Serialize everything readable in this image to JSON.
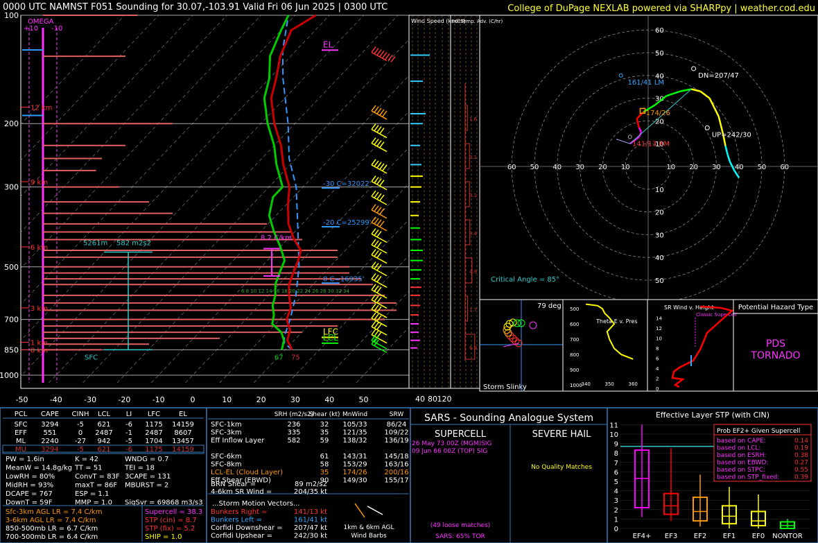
{
  "header": {
    "title": "0000 UTC NAMNST F051 Sounding for 30.07,-103.91 Valid  Fri 06 Jun 2025 | 0300 UTC",
    "credit": "College of DuPage NEXLAB powered via SHARPpy | weather.cod.edu"
  },
  "colors": {
    "temperature": "#cc0000",
    "dewpoint": "#00cc00",
    "parcel": "#3399ff",
    "panel_border": "#3a7ab8",
    "orange": "#ff9900",
    "magenta": "#ff33ff",
    "cyan": "#33cccc",
    "yellow": "#ffff00"
  },
  "skewt": {
    "omega": {
      "label": "OMEGA",
      "left": "+10",
      "right": "-10"
    },
    "pressure_ticks": [
      100,
      200,
      300,
      500,
      700,
      850,
      1000
    ],
    "temp_ticks": [
      -50,
      -40,
      -30,
      -20,
      -10,
      0,
      10,
      20,
      30,
      40,
      50
    ],
    "height_labels": [
      "12 km",
      "9 km",
      "6 km",
      "3 km",
      "1 km",
      "0 km"
    ],
    "height_km": [
      12,
      9,
      6,
      3,
      1,
      0
    ],
    "height_pressure": [
      180,
      290,
      440,
      650,
      810,
      850
    ],
    "EL": {
      "label": "EL",
      "p": 125
    },
    "LFC": {
      "label": "LFC",
      "p": 785
    },
    "LCL": {
      "label": "LCL",
      "p": 815
    },
    "wetbulb_zero": [
      {
        "label": "-30 C=32022'",
        "p": 302
      },
      {
        "label": "-20 C=25299'",
        "p": 387
      },
      {
        "label": "0 C=16935'",
        "p": 555
      }
    ],
    "lapse_label": "8.2 C/km",
    "eff_inflow": {
      "top_label": "5261m",
      "srh_label": "582 m2s2",
      "bottom_label": "SFC",
      "p_top": 455,
      "p_bot": 850
    },
    "sfc_temp": "75",
    "sfc_dwpt": "67",
    "wetbulb_scale": "6 8 10 12 14 16 18 20 22 24 26 28 30 32 34",
    "temperature": [
      [
        850,
        22
      ],
      [
        800,
        18
      ],
      [
        750,
        16
      ],
      [
        700,
        12
      ],
      [
        650,
        10
      ],
      [
        600,
        6
      ],
      [
        560,
        3
      ],
      [
        520,
        1
      ],
      [
        480,
        -1
      ],
      [
        450,
        -3
      ],
      [
        420,
        -8
      ],
      [
        380,
        -14
      ],
      [
        340,
        -19
      ],
      [
        300,
        -24
      ],
      [
        260,
        -32
      ],
      [
        230,
        -38
      ],
      [
        200,
        -46
      ],
      [
        170,
        -54
      ],
      [
        150,
        -58
      ],
      [
        130,
        -63
      ],
      [
        110,
        -67
      ],
      [
        100,
        -64
      ]
    ],
    "dewpoint": [
      [
        850,
        19
      ],
      [
        800,
        17
      ],
      [
        760,
        14
      ],
      [
        720,
        9
      ],
      [
        680,
        7
      ],
      [
        640,
        4
      ],
      [
        600,
        2
      ],
      [
        560,
        -1
      ],
      [
        520,
        -3
      ],
      [
        480,
        -5
      ],
      [
        440,
        -10
      ],
      [
        400,
        -16
      ],
      [
        360,
        -22
      ],
      [
        320,
        -26
      ],
      [
        300,
        -26
      ],
      [
        260,
        -34
      ],
      [
        230,
        -40
      ],
      [
        200,
        -48
      ],
      [
        170,
        -56
      ],
      [
        150,
        -60
      ],
      [
        130,
        -66
      ],
      [
        110,
        -70
      ],
      [
        100,
        -72
      ]
    ],
    "parcel": [
      [
        850,
        22
      ],
      [
        815,
        18
      ],
      [
        780,
        16
      ],
      [
        700,
        13
      ],
      [
        600,
        8
      ],
      [
        500,
        1
      ],
      [
        400,
        -9
      ],
      [
        300,
        -22
      ],
      [
        250,
        -32
      ],
      [
        200,
        -42
      ],
      [
        150,
        -56
      ],
      [
        125,
        -64
      ],
      [
        100,
        -72
      ]
    ],
    "omega_bars": [
      [
        100,
        -16
      ],
      [
        130,
        -14
      ],
      [
        200,
        -22
      ],
      [
        230,
        -14
      ],
      [
        250,
        -10
      ],
      [
        270,
        -9
      ],
      [
        300,
        -13
      ],
      [
        330,
        -18
      ],
      [
        355,
        -22
      ],
      [
        380,
        -38
      ],
      [
        400,
        -42
      ],
      [
        420,
        -44
      ],
      [
        450,
        -50
      ],
      [
        470,
        -50
      ],
      [
        500,
        -52
      ],
      [
        520,
        -52
      ],
      [
        540,
        -54
      ],
      [
        560,
        -56
      ],
      [
        600,
        -58
      ],
      [
        630,
        -60
      ],
      [
        660,
        -60
      ],
      [
        700,
        -58
      ],
      [
        730,
        -50
      ],
      [
        760,
        -44
      ],
      [
        790,
        -30
      ],
      [
        820,
        -18
      ],
      [
        850,
        -10
      ]
    ]
  },
  "wind_speed": {
    "label": "Wind Speed (knots)",
    "ticks": [
      "40",
      "80",
      "120"
    ]
  },
  "inferred_temp": {
    "label": "Inf. Temp. Adv. (C/hr)",
    "values": [
      "1.6",
      "3.1",
      "3.1",
      "3.4",
      "4.9",
      "1.7",
      "6.9"
    ]
  },
  "hodograph": {
    "rings": [
      "10",
      "20",
      "30",
      "40",
      "50",
      "60"
    ],
    "critical_angle": "Critical Angle = 85°",
    "DN": "DN=207/47",
    "UP": "UP=242/30",
    "LM": "161/41 LM",
    "RM": "141/13 RM",
    "mean": "174/26",
    "trace": [
      [
        -8,
        10
      ],
      [
        -4,
        13
      ],
      [
        -3,
        15
      ],
      [
        -4,
        17
      ],
      [
        -5,
        21
      ],
      [
        -2,
        24
      ],
      [
        3,
        27
      ],
      [
        8,
        31
      ],
      [
        14,
        33
      ],
      [
        19,
        34
      ],
      [
        23,
        33
      ],
      [
        27,
        30
      ],
      [
        29,
        26
      ],
      [
        31,
        22
      ],
      [
        32,
        18
      ],
      [
        33,
        14
      ],
      [
        34,
        9
      ],
      [
        35,
        5
      ],
      [
        36,
        2
      ],
      [
        38,
        -2
      ],
      [
        40,
        -5
      ]
    ],
    "trace_colors": [
      "#ff00ff",
      "#ff00ff",
      "#ff00ff",
      "#ff0000",
      "#ff0000",
      "#00ff00",
      "#00ff00",
      "#00ff00",
      "#00ff00",
      "#ffff00",
      "#ffff00",
      "#ffff00",
      "#ffff00",
      "#ffff00",
      "#ffff00",
      "#ffff00",
      "#00ffff",
      "#00ffff",
      "#00ffff",
      "#00ffff"
    ]
  },
  "slinky": {
    "deg": "79 deg",
    "title": "Storm Slinky"
  },
  "theta": {
    "label": "Theta-E v. Pres",
    "y_ticks": [
      "500",
      "600",
      "700",
      "800",
      "900",
      "1000"
    ],
    "x_ticks": [
      "340",
      "350",
      "360"
    ],
    "trace": [
      [
        340,
        470
      ],
      [
        345,
        480
      ],
      [
        347,
        500
      ],
      [
        348,
        530
      ],
      [
        350,
        560
      ],
      [
        352,
        600
      ],
      [
        349,
        650
      ],
      [
        350,
        700
      ],
      [
        352,
        760
      ],
      [
        355,
        800
      ],
      [
        360,
        830
      ]
    ]
  },
  "srwind": {
    "label": "SR Wind v. Height",
    "classic": "Classic Supercell",
    "y_ticks": [
      "0",
      "2",
      "4",
      "6",
      "8",
      "10",
      "12",
      "14"
    ]
  },
  "hazard": {
    "title": "Potential Hazard Type",
    "value": "PDS TORNADO"
  },
  "parcels": {
    "headers": [
      "PCL",
      "CAPE",
      "CINH",
      "LCL",
      "LI",
      "LFC",
      "EL"
    ],
    "rows": [
      [
        "SFC",
        "3294",
        "-5",
        "621",
        "-6",
        "1175",
        "14159"
      ],
      [
        "EFF",
        "551",
        "0",
        "2487",
        "-1",
        "2487",
        "8607"
      ],
      [
        "ML",
        "2240",
        "-27",
        "942",
        "-5",
        "1704",
        "13457"
      ],
      [
        "MU",
        "3294",
        "-5",
        "621",
        "-6",
        "1175",
        "14159"
      ]
    ]
  },
  "indices": [
    [
      "PW = 1.6in",
      "K = 42",
      "WNDG = 0.7"
    ],
    [
      "MeanW = 14.8g/kg",
      "TT = 51",
      "TEI = 18"
    ],
    [
      "LowRH = 80%",
      "ConvT = 83F",
      "3CAPE = 131"
    ],
    [
      "MidRH = 93%",
      "maxT = 86F",
      "MBURST = 2"
    ],
    [
      "DCAPE = 767",
      "ESP = 1.1",
      ""
    ],
    [
      "DownT = 59F",
      "MMP = 1.0",
      "SigSvr = 69868 m3/s3"
    ]
  ],
  "lapse_rates": [
    {
      "label": "Sfc-3km AGL LR = 7.4 C/km",
      "color": "#ff9900"
    },
    {
      "label": "3-6km AGL LR = 7.4 C/km",
      "color": "#ff9900"
    },
    {
      "label": "850-500mb LR = 6.7 C/km",
      "color": "#ffffff"
    },
    {
      "label": "700-500mb LR = 6.4 C/km",
      "color": "#ffffff"
    }
  ],
  "composites": [
    {
      "label": "Supercell = 38.3",
      "color": "#ff33ff"
    },
    {
      "label": "STP (cin) = 8.7",
      "color": "#ff3333"
    },
    {
      "label": "STP (fix) = 5.2",
      "color": "#ff3333"
    },
    {
      "label": "SHIP = 1.0",
      "color": "#ffff00"
    }
  ],
  "kinematics": {
    "headers": [
      "SRH (m2/s2)",
      "Shear (kt)",
      "MnWind",
      "SRW"
    ],
    "rows": [
      {
        "name": "SFC-1km",
        "srh": "236",
        "shear": "32",
        "mn": "105/33",
        "srw": "86/24",
        "color": "#ffffff"
      },
      {
        "name": "SFC-3km",
        "srh": "335",
        "shear": "35",
        "mn": "121/35",
        "srw": "109/22",
        "color": "#ffffff"
      },
      {
        "name": "Eff Inflow Layer",
        "srh": "582",
        "shear": "59",
        "mn": "138/32",
        "srw": "136/19",
        "color": "#ffffff"
      },
      {
        "name": "",
        "srh": "",
        "shear": "",
        "mn": "",
        "srw": "",
        "color": "#ffffff"
      },
      {
        "name": "SFC-6km",
        "srh": "",
        "shear": "61",
        "mn": "143/31",
        "srw": "145/18",
        "color": "#ffffff"
      },
      {
        "name": "SFC-8km",
        "srh": "",
        "shear": "58",
        "mn": "153/29",
        "srw": "163/16",
        "color": "#ffffff"
      },
      {
        "name": "LCL-EL (Cloud Layer)",
        "srh": "",
        "shear": "35",
        "mn": "174/26",
        "srw": "200/16",
        "color": "#ff9900"
      },
      {
        "name": "Eff Shear (EBWD)",
        "srh": "",
        "shear": "90",
        "mn": "149/30",
        "srw": "155/17",
        "color": "#ffffff"
      }
    ],
    "brn": [
      "BRN Shear =",
      "89 m2/s2"
    ],
    "sr_wind": [
      "4-6km SR Wind =",
      "204/35 kt"
    ],
    "vectors_title": "...Storm Motion Vectors...",
    "vectors": [
      {
        "name": "Bunkers Right =",
        "value": "141/13 kt",
        "color": "#ff3333"
      },
      {
        "name": "Bunkers Left =",
        "value": "161/41 kt",
        "color": "#33aaff"
      },
      {
        "name": "Corfidi Downshear =",
        "value": "207/47 kt",
        "color": "#ffffff"
      },
      {
        "name": "Corfidi Upshear =",
        "value": "242/30 kt",
        "color": "#ffffff"
      }
    ],
    "barbs_label_1": "1km & 6km AGL",
    "barbs_label_2": "Wind Barbs"
  },
  "sars": {
    "title": "SARS - Sounding Analogue System",
    "supercell": "SUPERCELL",
    "severe_hail": "SEVERE HAIL",
    "match1": "26 May 73 00Z (MGM)SIG",
    "match2": "09 Jun 66 00Z (TOP)   SIG",
    "no_match": "No Quality Matches",
    "loose": "(49 loose matches)",
    "tor": "SARS: 65% TOR"
  },
  "stp": {
    "title": "Effective Layer STP (with CIN)",
    "y_ticks": [
      "0",
      "1",
      "2",
      "3",
      "4",
      "5",
      "6",
      "7",
      "8",
      "9",
      "10",
      "11"
    ],
    "categories": [
      "EF4+",
      "EF3",
      "EF2",
      "EF1",
      "EF0",
      "NONTOR"
    ],
    "boxes": [
      {
        "lo": 1.2,
        "q1": 2.2,
        "med": 5.3,
        "q3": 8.3,
        "hi": 11.0,
        "color": "#ff00ff"
      },
      {
        "lo": 0.8,
        "q1": 1.5,
        "med": 2.4,
        "q3": 3.7,
        "hi": 8.5,
        "color": "#ff0000"
      },
      {
        "lo": 0.2,
        "q1": 0.8,
        "med": 1.8,
        "q3": 3.3,
        "hi": 5.7,
        "color": "#ff9900"
      },
      {
        "lo": 0.0,
        "q1": 0.5,
        "med": 1.3,
        "q3": 2.4,
        "hi": 4.4,
        "color": "#ffff00"
      },
      {
        "lo": 0.0,
        "q1": 0.3,
        "med": 0.8,
        "q3": 1.8,
        "hi": 3.6,
        "color": "#ffff00"
      },
      {
        "lo": 0.0,
        "q1": 0.0,
        "med": 0.3,
        "q3": 0.7,
        "hi": 1.0,
        "color": "#00ff00"
      }
    ],
    "current": 8.7,
    "legend_title": "Prob EF2+ Given Supercell",
    "legend": [
      {
        "name": "based on CAPE:",
        "value": "0.14"
      },
      {
        "name": "based on LCL:",
        "value": "0.19"
      },
      {
        "name": "based on ESRH:",
        "value": "0.38"
      },
      {
        "name": "based on EBWD:",
        "value": "0.27"
      },
      {
        "name": "based on STPC:",
        "value": "0.55"
      },
      {
        "name": "based on STP_fixed:",
        "value": "0.39"
      }
    ]
  }
}
